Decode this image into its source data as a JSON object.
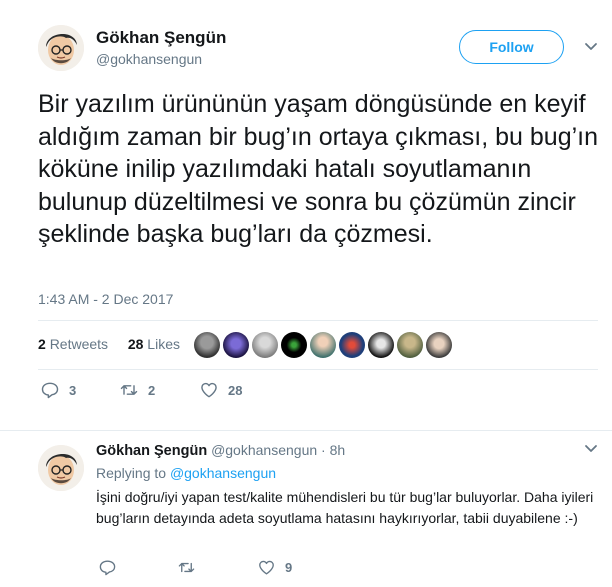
{
  "main_tweet": {
    "author_name": "Gökhan Şengün",
    "author_handle": "@gokhansengun",
    "follow_label": "Follow",
    "text": "Bir yazılım ürününün yaşam döngüsünde en keyif aldığım zaman bir bug’ın ortaya çıkması, bu bug’ın köküne inilip yazılımdaki hatalı soyutlamanın bulunup düzeltilmesi ve sonra bu çözümün zincir şeklinde başka bug’ları da çözmesi.",
    "timestamp": "1:43 AM - 2 Dec 2017",
    "retweet_count": "2",
    "retweet_label": "Retweets",
    "like_count": "28",
    "like_label": "Likes",
    "actions": {
      "reply_count": "3",
      "retweet_count": "2",
      "like_count": "28"
    }
  },
  "reply_tweet": {
    "author_name": "Gökhan Şengün",
    "author_handle": "@gokhansengun",
    "separator": "·",
    "time": "8h",
    "replying_prefix": "Replying to",
    "replying_to": "@gokhansengun",
    "text": "İşini doğru/iyi yapan test/kalite mühendisleri bu tür bug’lar buluyorlar. Daha iyileri bug’ların detayında adeta soyutlama hatasını haykırıyorlar, tabii duyabilene :-)",
    "actions": {
      "reply_count": "",
      "retweet_count": "",
      "like_count": "9"
    }
  },
  "icons": [
    "avatar",
    "caret-down-icon",
    "reply-icon",
    "retweet-icon",
    "heart-icon"
  ],
  "colors": {
    "accent": "#1da1f2",
    "muted": "#657786",
    "text": "#14171a",
    "divider": "#e6ecf0"
  }
}
